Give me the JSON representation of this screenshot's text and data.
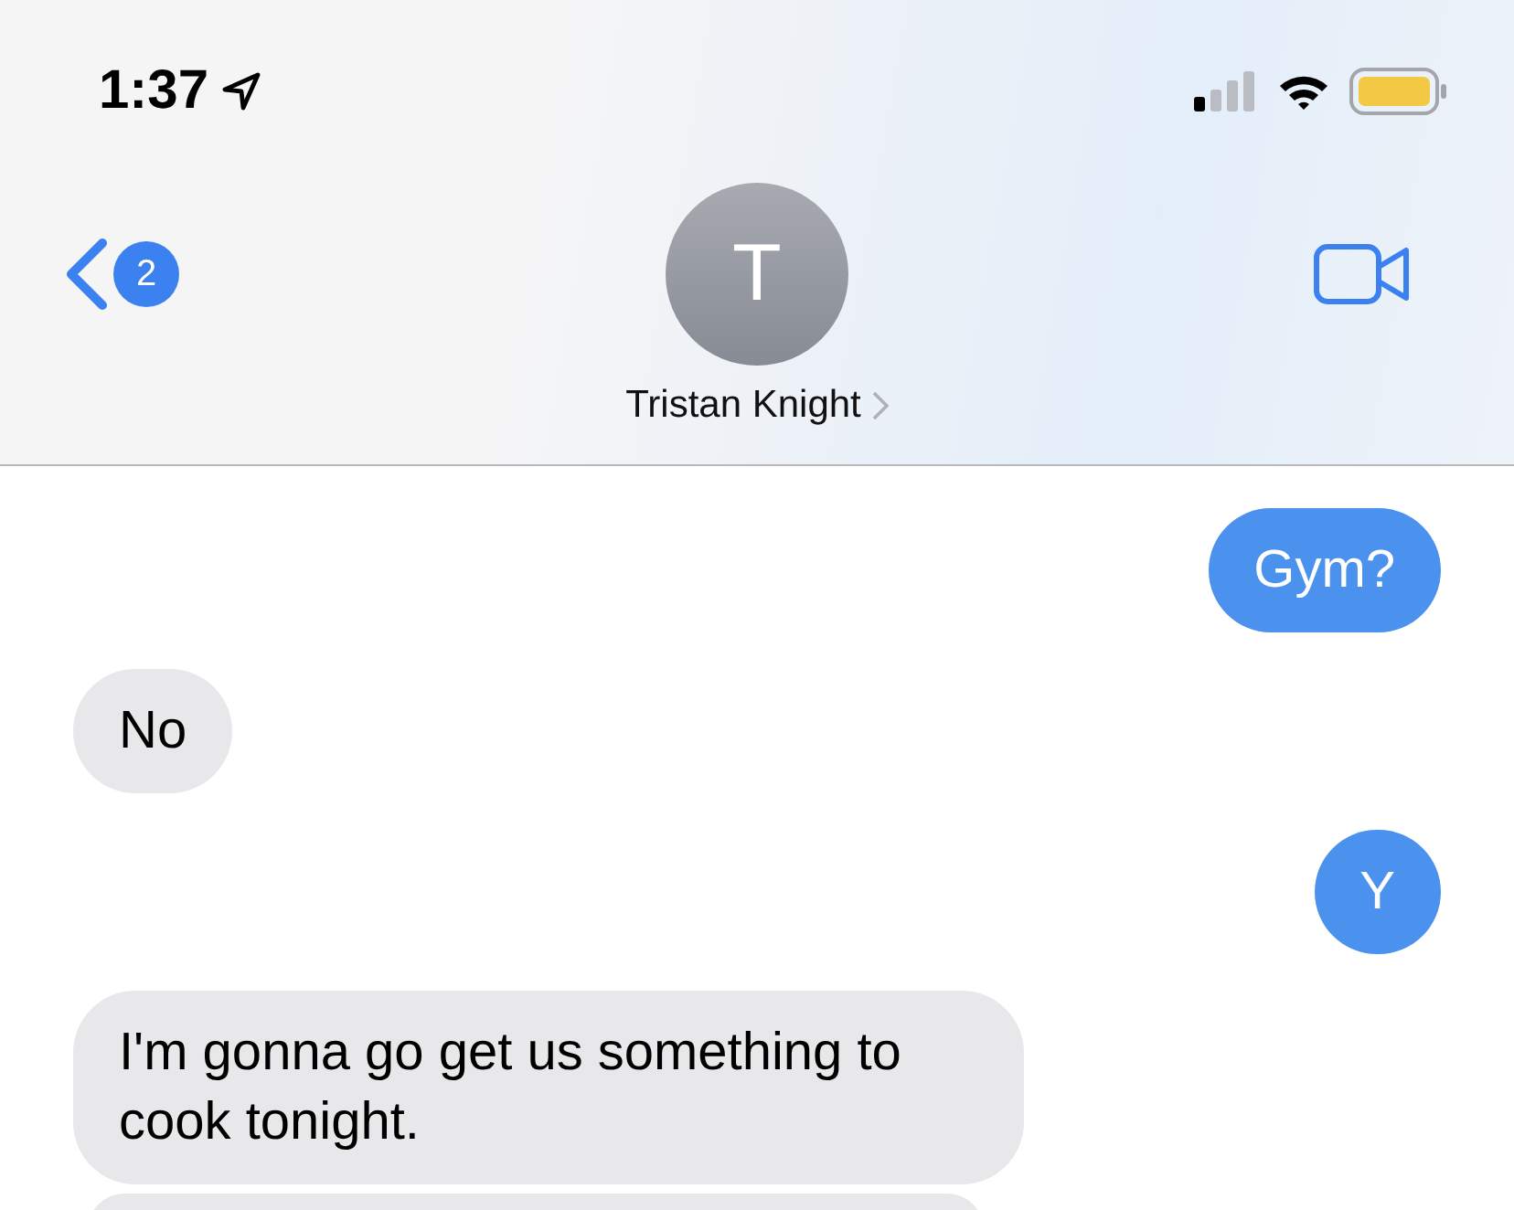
{
  "status_bar": {
    "time": "1:37"
  },
  "header": {
    "back_badge": "2",
    "avatar_initial": "T",
    "contact_name": "Tristan Knight"
  },
  "messages": [
    {
      "kind": "outgoing",
      "text": "Gym?"
    },
    {
      "kind": "incoming",
      "text": "No"
    },
    {
      "kind": "outgoing",
      "text": "Y"
    },
    {
      "kind": "incoming",
      "text": "I'm gonna go get us something to cook tonight."
    },
    {
      "kind": "incoming"
    }
  ]
}
